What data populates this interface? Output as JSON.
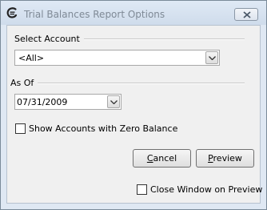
{
  "window": {
    "title": "Trial Balances Report Options",
    "app_icon": "c-logo-icon",
    "close_icon": "close-x-icon"
  },
  "account": {
    "group_label": "Select Account",
    "selected": "<All>"
  },
  "as_of": {
    "group_label": "As Of",
    "date": "07/31/2009"
  },
  "zero_balance": {
    "label": "Show Accounts with Zero Balance",
    "checked": false
  },
  "buttons": {
    "cancel": {
      "mnemonic": "C",
      "rest": "ancel"
    },
    "preview": {
      "mnemonic": "P",
      "rest": "review"
    }
  },
  "close_on_preview": {
    "label": "Close Window on Preview",
    "checked": false
  }
}
